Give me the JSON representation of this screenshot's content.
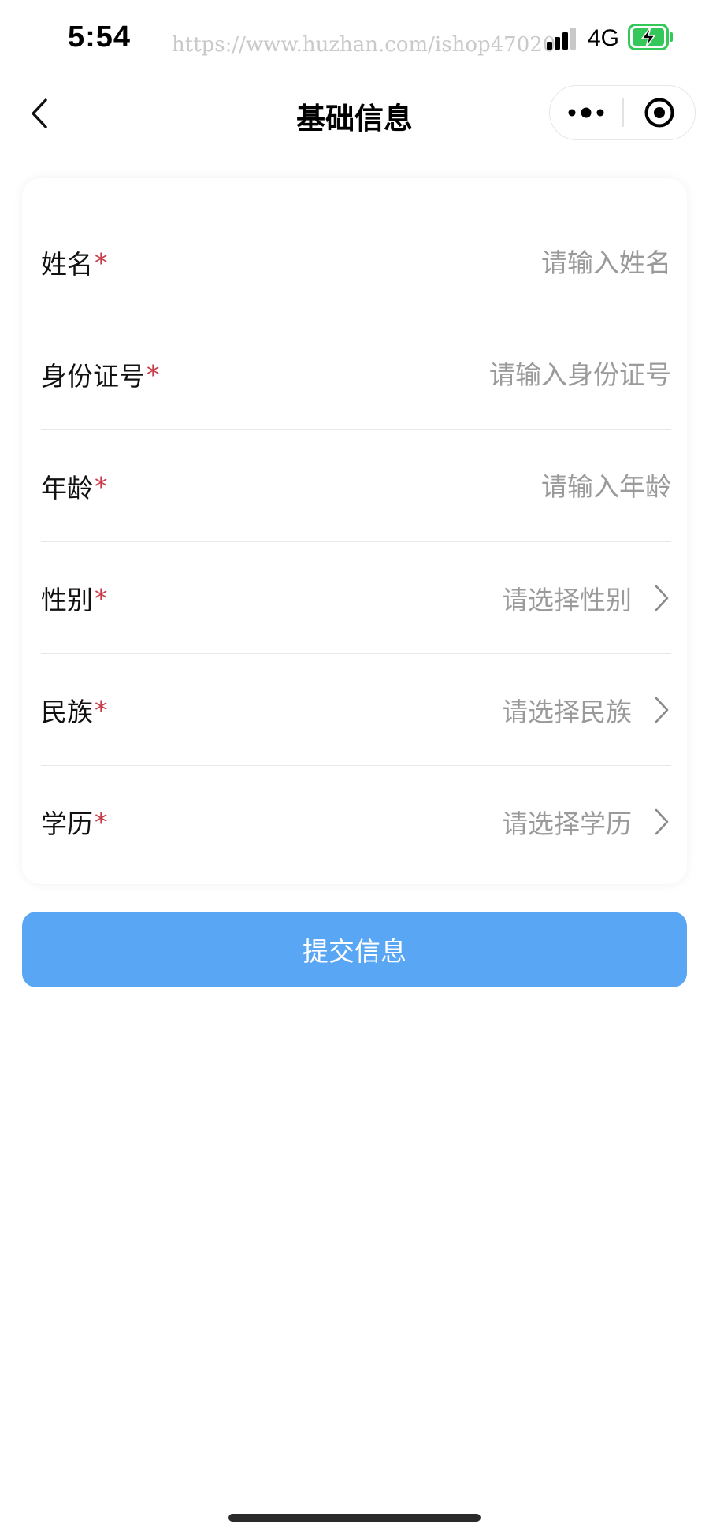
{
  "status_bar": {
    "time": "5:54",
    "watermark": "https://www.huzhan.com/ishop47020",
    "network": "4G",
    "icons": {
      "signal": "signal-bars-icon",
      "battery": "battery-charging-icon"
    },
    "battery_color": "#34c759"
  },
  "nav": {
    "title": "基础信息",
    "icons": {
      "back": "chevron-left-icon",
      "more": "more-dots-icon",
      "close": "target-circle-icon"
    }
  },
  "form": {
    "required_mark": "*",
    "required_color": "#c83c4a",
    "fields": [
      {
        "label": "姓名",
        "type": "input",
        "value": "",
        "placeholder": "请输入姓名"
      },
      {
        "label": "身份证号",
        "type": "input",
        "value": "",
        "placeholder": "请输入身份证号"
      },
      {
        "label": "年龄",
        "type": "input",
        "value": "",
        "placeholder": "请输入年龄"
      },
      {
        "label": "性别",
        "type": "select",
        "placeholder": "请选择性别"
      },
      {
        "label": "民族",
        "type": "select",
        "placeholder": "请选择民族"
      },
      {
        "label": "学历",
        "type": "select",
        "placeholder": "请选择学历"
      }
    ]
  },
  "submit": {
    "label": "提交信息",
    "color": "#58a6f4"
  }
}
